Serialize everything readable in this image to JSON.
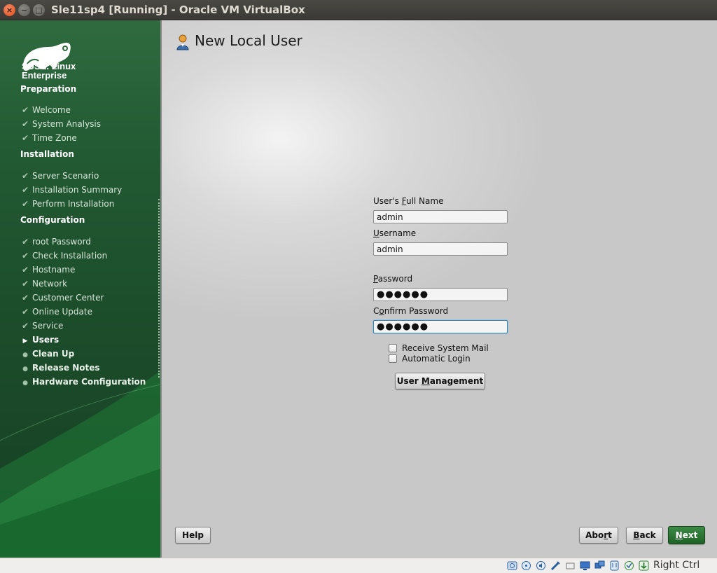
{
  "window": {
    "title": "Sle11sp4 [Running] - Oracle VM VirtualBox",
    "close_glyph": "×",
    "minimize_glyph": "−",
    "maximize_glyph": "□"
  },
  "brand": {
    "line1": "SUSE. Linux",
    "line2": "Enterprise"
  },
  "sidebar": {
    "sections": [
      {
        "heading": "Preparation",
        "steps": [
          {
            "label": "Welcome",
            "state": "done"
          },
          {
            "label": "System Analysis",
            "state": "done"
          },
          {
            "label": "Time Zone",
            "state": "done"
          }
        ]
      },
      {
        "heading": "Installation",
        "steps": [
          {
            "label": "Server Scenario",
            "state": "done"
          },
          {
            "label": "Installation Summary",
            "state": "done"
          },
          {
            "label": "Perform Installation",
            "state": "done"
          }
        ]
      },
      {
        "heading": "Configuration",
        "steps": [
          {
            "label": "root Password",
            "state": "done"
          },
          {
            "label": "Check Installation",
            "state": "done"
          },
          {
            "label": "Hostname",
            "state": "done"
          },
          {
            "label": "Network",
            "state": "done"
          },
          {
            "label": "Customer Center",
            "state": "done"
          },
          {
            "label": "Online Update",
            "state": "done"
          },
          {
            "label": "Service",
            "state": "done"
          },
          {
            "label": "Users",
            "state": "current"
          },
          {
            "label": "Clean Up",
            "state": "pending"
          },
          {
            "label": "Release Notes",
            "state": "pending"
          },
          {
            "label": "Hardware Configuration",
            "state": "pending"
          }
        ]
      }
    ],
    "marks": {
      "done": "✔",
      "current": "▶",
      "pending": "●"
    }
  },
  "page": {
    "title": "New Local User",
    "title_icon": "user-icon"
  },
  "form": {
    "full_name": {
      "label_pre": "User's ",
      "label_accel": "F",
      "label_post": "ull Name",
      "value": "admin"
    },
    "username": {
      "label_pre": "",
      "label_accel": "U",
      "label_post": "sername",
      "value": "admin"
    },
    "password": {
      "label_pre": "",
      "label_accel": "P",
      "label_post": "assword",
      "value": "●●●●●●"
    },
    "confirm_password": {
      "label_pre": "C",
      "label_accel": "o",
      "label_post": "nfirm Password",
      "value": "●●●●●●"
    },
    "receive_mail": {
      "label": "Receive System Mail",
      "checked": false
    },
    "auto_login": {
      "label": "Automatic Login",
      "checked": false
    },
    "user_mgmt": {
      "pre": "User ",
      "accel": "M",
      "post": "anagement"
    }
  },
  "buttons": {
    "help": "Help",
    "abort": {
      "pre": "Abo",
      "accel": "r",
      "post": "t"
    },
    "back": {
      "pre": "",
      "accel": "B",
      "post": "ack"
    },
    "next": {
      "pre": "",
      "accel": "N",
      "post": "ext"
    }
  },
  "statusbar": {
    "host_key": "Right Ctrl",
    "icons": [
      "hard-disk-icon",
      "optical-drive-icon",
      "audio-icon",
      "network-icon",
      "usb-icon",
      "shared-folder-icon",
      "display-icon",
      "video-capture-icon",
      "cpu-icon",
      "mouse-integration-icon",
      "keyboard-capture-icon"
    ]
  },
  "colors": {
    "sidebar_green": "#225a33",
    "next_button_green": "#2c7a36",
    "title_bar": "#3c3b37",
    "close_button": "#df4a16"
  }
}
